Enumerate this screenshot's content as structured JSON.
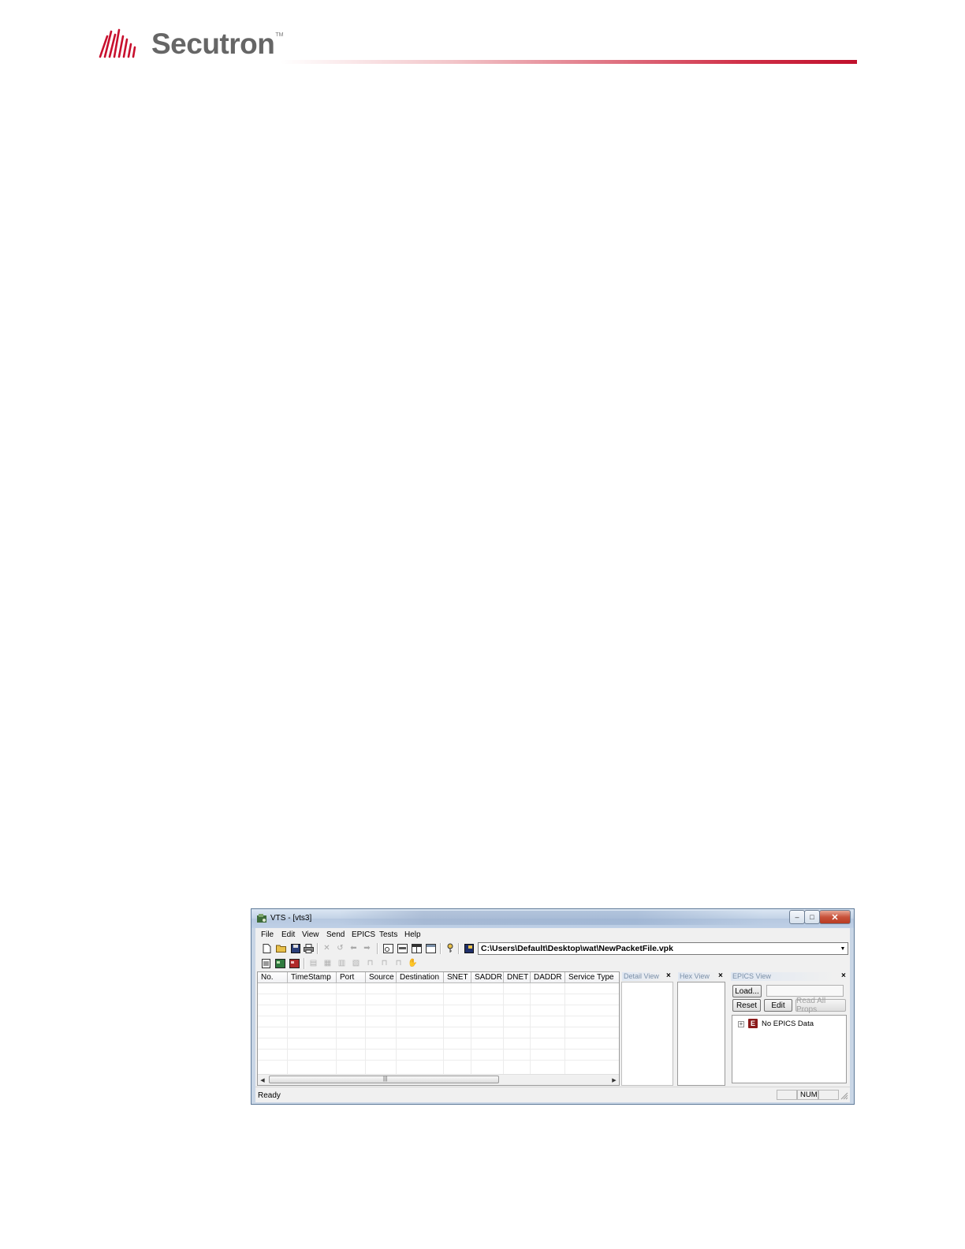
{
  "header": {
    "brand": "Secutron",
    "trademark": "TM",
    "accent_color": "#c8102e"
  },
  "window": {
    "title": "VTS - [vts3]",
    "controls": {
      "minimize": "–",
      "maximize": "□",
      "close": "✕"
    },
    "menu": [
      "File",
      "Edit",
      "View",
      "Send",
      "EPICS",
      "Tests",
      "Help"
    ],
    "toolbar_path": "C:\\Users\\Default\\Desktop\\wat\\NewPacketFile.vpk",
    "packet_list": {
      "columns": [
        "No.",
        "TimeStamp",
        "Port",
        "Source",
        "Destination",
        "SNET",
        "SADDR",
        "DNET",
        "DADDR",
        "Service Type"
      ]
    },
    "panes": {
      "detail": "Detail View",
      "hex": "Hex View",
      "epics": "EPICS View"
    },
    "epics": {
      "load_button": "Load...",
      "reset_button": "Reset",
      "edit_button": "Edit",
      "read_all_button": "Read All Props",
      "tree_item": "No EPICS Data",
      "tree_icon_letter": "E"
    },
    "status": {
      "text": "Ready",
      "num": "NUM"
    }
  }
}
